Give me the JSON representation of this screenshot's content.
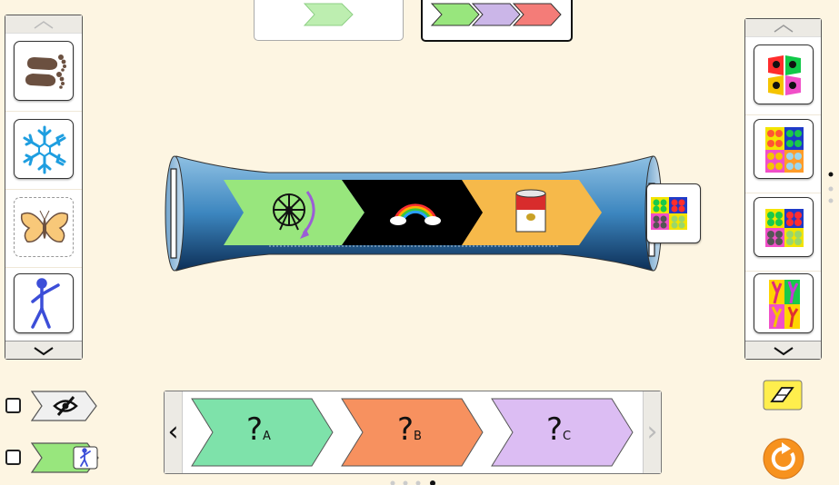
{
  "bottom_bar": {
    "slots": [
      {
        "glyph": "?",
        "sub": "A",
        "color": "#7ee2aa"
      },
      {
        "glyph": "?",
        "sub": "B",
        "color": "#f7915f"
      },
      {
        "glyph": "?",
        "sub": "C",
        "color": "#dcbdf3"
      }
    ],
    "left_arrow": "‹",
    "right_arrow": "›"
  },
  "left_palette": {
    "items": [
      "footprints-card",
      "snowflake-card",
      "butterfly-card",
      "stick-figure-card"
    ]
  },
  "right_palette": {
    "items": [
      "pattern-card-1",
      "pattern-card-2",
      "pattern-card-3",
      "pattern-card-4"
    ]
  },
  "tube": {
    "segments": [
      {
        "icon": "ferris-wheel",
        "color": "#98e67d"
      },
      {
        "icon": "rainbow",
        "color": "#000000"
      },
      {
        "icon": "soup-can",
        "color": "#f6b94a"
      }
    ]
  },
  "top_boxes": {
    "left_colors": [
      "#bdeeb0"
    ],
    "right_colors": [
      "#98e67d",
      "#cbb6e8",
      "#f47c78"
    ]
  },
  "colors": {
    "background": "#fdf5e2",
    "eraser": "#ffee4d",
    "reset": "#f7921e"
  }
}
